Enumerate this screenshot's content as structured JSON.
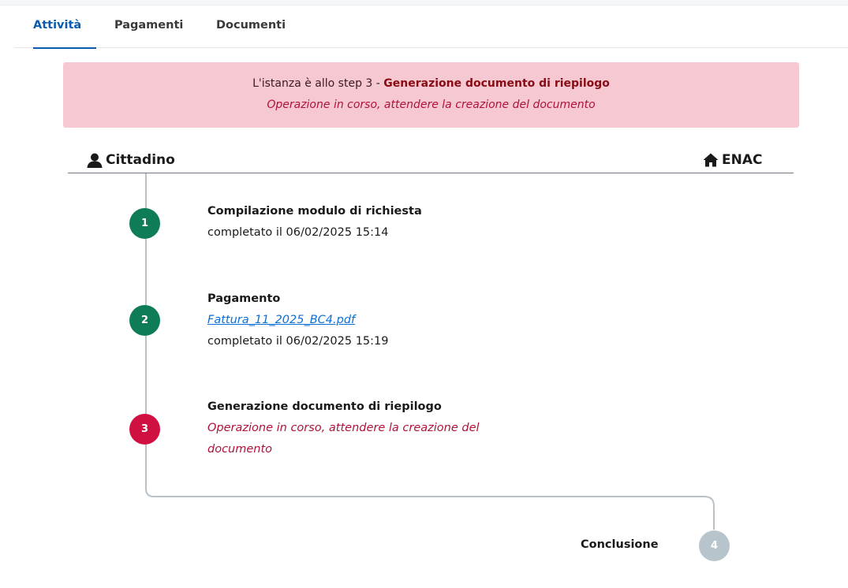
{
  "tabs": [
    {
      "label": "Attività",
      "active": true
    },
    {
      "label": "Pagamenti",
      "active": false
    },
    {
      "label": "Documenti",
      "active": false
    }
  ],
  "alert": {
    "prefix": "L'istanza è allo step 3 - ",
    "step_name": "Generazione documento di riepilogo",
    "message": "Operazione in corso, attendere la creazione del documento"
  },
  "actors": {
    "left": {
      "label": "Cittadino",
      "icon": "user-icon"
    },
    "right": {
      "label": "ENAC",
      "icon": "home-icon"
    }
  },
  "steps": [
    {
      "number": "1",
      "title": "Compilazione modulo di richiesta",
      "status": "completato il 06/02/2025 15:14",
      "state": "done"
    },
    {
      "number": "2",
      "title": "Pagamento",
      "link": "Fattura_11_2025_BC4.pdf",
      "status": "completato il 06/02/2025 15:19",
      "state": "done"
    },
    {
      "number": "3",
      "title": "Generazione documento di riepilogo",
      "note": "Operazione in corso, attendere la creazione del documento",
      "state": "in-progress"
    },
    {
      "number": "4",
      "title": "Conclusione",
      "state": "pending"
    }
  ],
  "colors": {
    "done": "#0e7d57",
    "in_progress": "#d01040",
    "pending": "#b8c4cc",
    "accent": "#0b5cad",
    "alert_bg": "#f6c8d1"
  }
}
